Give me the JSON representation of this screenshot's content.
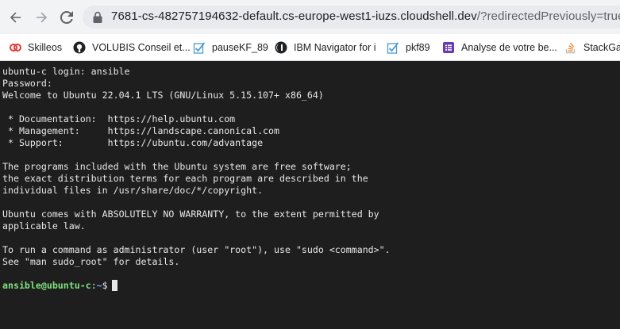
{
  "browser": {
    "url_host": "7681-cs-482757194632-default.cs-europe-west1-iuzs.cloudshell.dev",
    "url_path": "/?redirectedPreviously=true",
    "nav": {
      "back_icon": "arrow-left-icon",
      "forward_icon": "arrow-right-icon",
      "reload_icon": "reload-icon",
      "lock_icon": "lock-icon"
    }
  },
  "bookmarks": [
    {
      "label": "Skilleos",
      "icon": "skilleos-icon",
      "color": "#e53935"
    },
    {
      "label": "VOLUBIS Conseil et...",
      "icon": "github-icon",
      "color": "#202124"
    },
    {
      "label": "pauseKF_89",
      "icon": "check-doc-icon",
      "color": "#4a9bd4"
    },
    {
      "label": "IBM Navigator for i",
      "icon": "ibm-icon",
      "color": "#202124"
    },
    {
      "label": "pkf89",
      "icon": "check-doc-icon",
      "color": "#4a9bd4"
    },
    {
      "label": "Analyse de votre be...",
      "icon": "form-icon",
      "color": "#673ab7"
    },
    {
      "label": "StackGai",
      "icon": "stackoverflow-icon",
      "color": "#f48024"
    }
  ],
  "terminal": {
    "lines": [
      "ubuntu-c login: ansible",
      "Password:",
      "Welcome to Ubuntu 22.04.1 LTS (GNU/Linux 5.15.107+ x86_64)",
      "",
      " * Documentation:  https://help.ubuntu.com",
      " * Management:     https://landscape.canonical.com",
      " * Support:        https://ubuntu.com/advantage",
      "",
      "The programs included with the Ubuntu system are free software;",
      "the exact distribution terms for each program are described in the",
      "individual files in /usr/share/doc/*/copyright.",
      "",
      "Ubuntu comes with ABSOLUTELY NO WARRANTY, to the extent permitted by",
      "applicable law.",
      "",
      "To run a command as administrator (user \"root\"), use \"sudo <command>\".",
      "See \"man sudo_root\" for details."
    ],
    "prompt_user": "ansible@ubuntu-c",
    "prompt_sep": ":",
    "prompt_path": "~",
    "prompt_symbol": "$",
    "colors": {
      "background": "#1e1e1e",
      "text": "#e8e8e8",
      "prompt_user": "#7ee27e",
      "prompt_path": "#6aa7ff"
    }
  }
}
